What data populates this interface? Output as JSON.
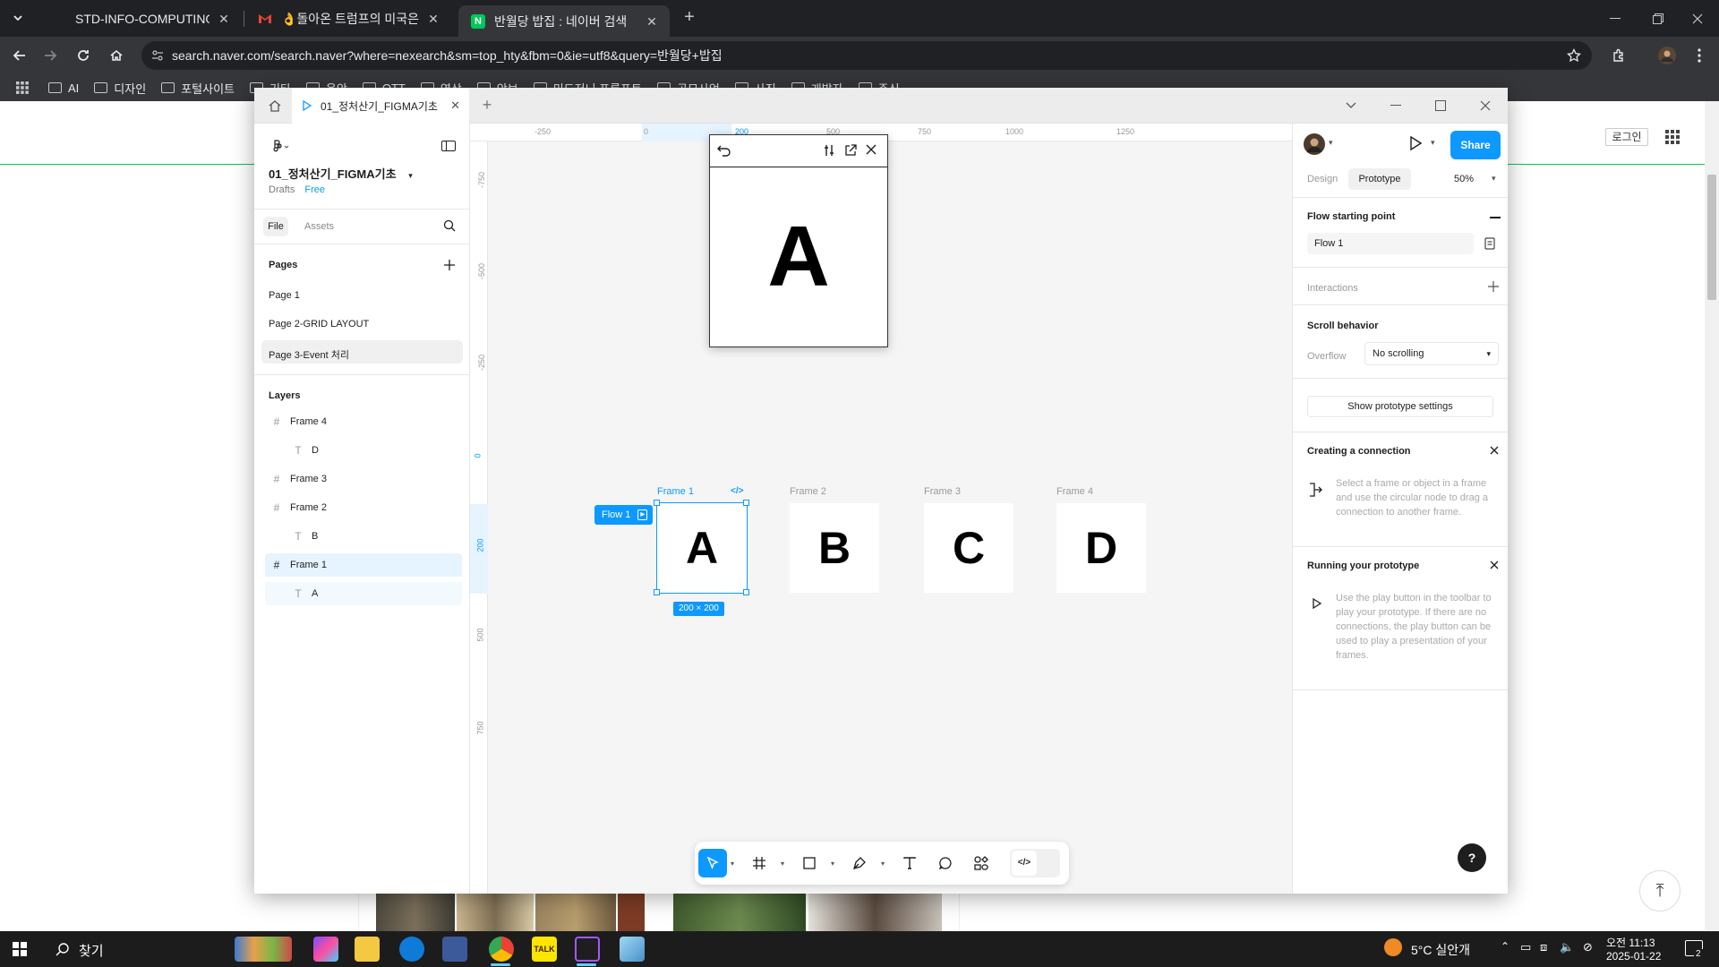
{
  "browser": {
    "tabs": [
      {
        "title": "STD-INFO-COMPUTING-WEB-...",
        "favicon": "github-icon"
      },
      {
        "title": "👌돌아온 트럼프의 미국은 '자유...",
        "favicon": "gmail-icon"
      },
      {
        "title": "반월당 밥집 : 네이버 검색",
        "favicon": "naver-icon",
        "active": true
      }
    ],
    "url": "search.naver.com/search.naver?where=nexearch&sm=top_hty&fbm=0&ie=utf8&query=반월당+밥집",
    "bookmarks": [
      "AI",
      "디자인",
      "포털사이트",
      "기타",
      "음악",
      "OTT",
      "영상",
      "악보",
      "미드저니 프롬프트",
      "공모사업",
      "사진",
      "개발자",
      "주식"
    ]
  },
  "naver": {
    "login": "로그인"
  },
  "figma": {
    "tab_title": "01_정처산기_FIGMA기초",
    "file_name": "01_정처산기_FIGMA기초",
    "drafts": "Drafts",
    "plan": "Free",
    "file_tab": "File",
    "assets_tab": "Assets",
    "pages_title": "Pages",
    "pages": [
      "Page 1",
      "Page 2-GRID LAYOUT",
      "Page 3-Event 처리"
    ],
    "layers_title": "Layers",
    "layers": [
      {
        "name": "Frame 4",
        "type": "frame"
      },
      {
        "name": "D",
        "type": "text"
      },
      {
        "name": "Frame 3",
        "type": "frame"
      },
      {
        "name": "Frame 2",
        "type": "frame"
      },
      {
        "name": "B",
        "type": "text"
      },
      {
        "name": "Frame 1",
        "type": "frame",
        "selected": true
      },
      {
        "name": "A",
        "type": "text"
      }
    ],
    "ruler_h": [
      "-250",
      "0",
      "200",
      "500",
      "750",
      "1000",
      "1250"
    ],
    "ruler_v": [
      "-750",
      "-500",
      "-250",
      "0",
      "200",
      "500",
      "750"
    ],
    "frames": [
      {
        "label": "Frame 1",
        "letter": "A"
      },
      {
        "label": "Frame 2",
        "letter": "B"
      },
      {
        "label": "Frame 3",
        "letter": "C"
      },
      {
        "label": "Frame 4",
        "letter": "D"
      }
    ],
    "flow_badge": "Flow 1",
    "size_badge": "200 × 200",
    "preview_letter": "A",
    "right": {
      "design_tab": "Design",
      "prototype_tab": "Prototype",
      "zoom": "50%",
      "share": "Share",
      "flow_start_title": "Flow starting point",
      "flow_name": "Flow 1",
      "interactions": "Interactions",
      "scroll_title": "Scroll behavior",
      "overflow_label": "Overflow",
      "overflow_value": "No scrolling",
      "show_settings": "Show prototype settings",
      "creating_title": "Creating a connection",
      "creating_help": "Select a frame or object in a frame and use the circular node to drag a connection to another frame.",
      "running_title": "Running your prototype",
      "running_help": "Use the play button in the toolbar to play your prototype. If there are no connections, the play button can be used to play a presentation of your frames."
    }
  },
  "taskbar": {
    "search": "찾기",
    "weather": "5°C  실안개",
    "time": "오전 11:13",
    "date": "2025-01-22",
    "notif": "2"
  }
}
